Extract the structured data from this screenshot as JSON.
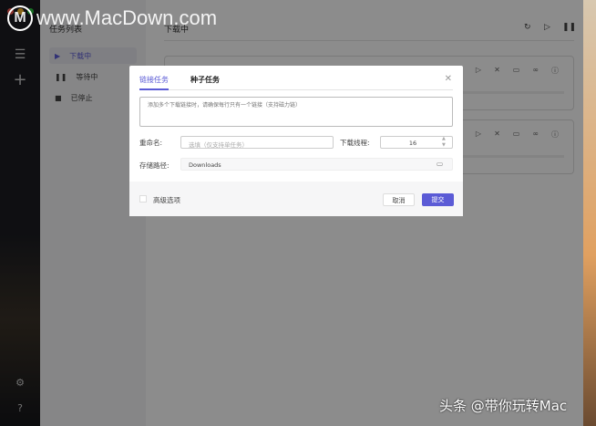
{
  "watermark": "www.MacDown.com",
  "watermark_logo": "M",
  "sidebar": {
    "title": "任务列表",
    "items": [
      {
        "label": "下载中",
        "icon": "play-icon"
      },
      {
        "label": "等待中",
        "icon": "pause-icon"
      },
      {
        "label": "已停止",
        "icon": "stop-icon"
      }
    ]
  },
  "main": {
    "title": "下载中"
  },
  "dialog": {
    "tabs": [
      "链接任务",
      "种子任务"
    ],
    "url_placeholder": "添加多个下载链接时，请确保每行只有一个链接（支持磁力链）",
    "rename_label": "重命名:",
    "rename_placeholder": "选填（仅支持单任务）",
    "threads_label": "下载线程:",
    "threads_value": "16",
    "path_label": "存储路径:",
    "path_value": "Downloads",
    "advanced_label": "高级选项",
    "cancel": "取消",
    "submit": "提交"
  },
  "footer_watermark": "头条 @带你玩转Mac",
  "colors": {
    "accent": "#5b5bd6"
  }
}
